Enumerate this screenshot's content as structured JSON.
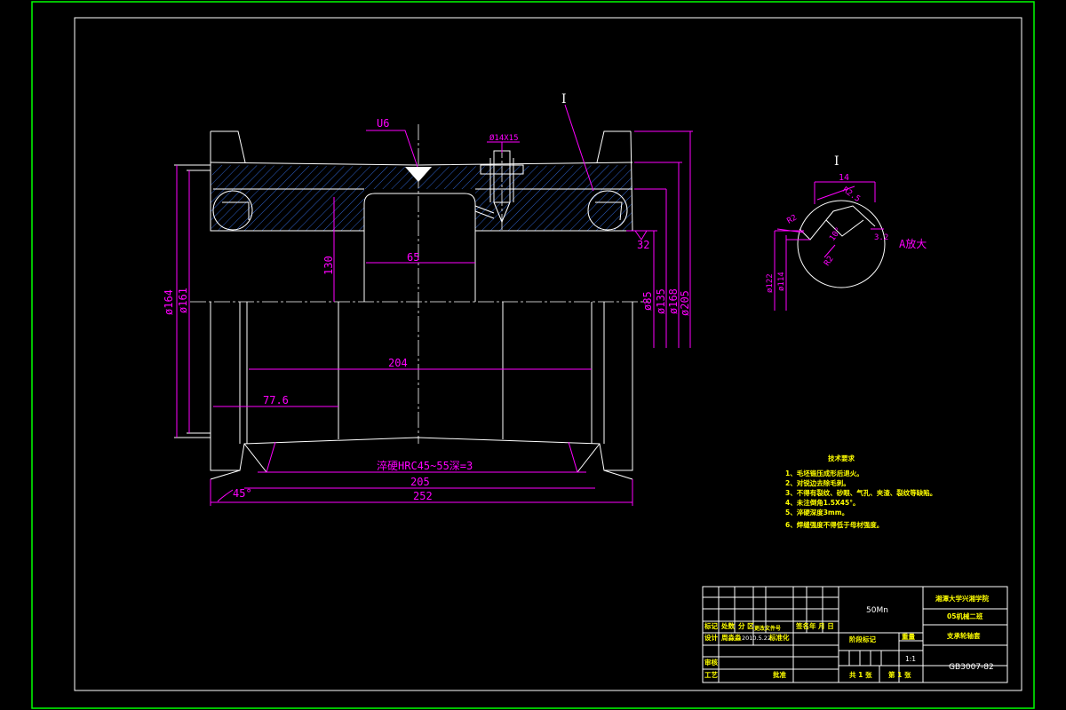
{
  "drawing": {
    "section_label": "I",
    "weld_symbol": "U6",
    "hole_callout": "Ø14X15",
    "dims": {
      "d164": "ø164",
      "d161": "ø161",
      "h130": "130",
      "w65": "65",
      "w204": "204",
      "w77_6": "77.6",
      "w205": "205",
      "w252": "252",
      "a45": "45°",
      "r32": "32",
      "d85": "ø85",
      "d135": "ø135",
      "d168": "ø168",
      "d205": "ø205",
      "hardening": "淬硬HRC45~55深=3"
    }
  },
  "detail": {
    "label": "I",
    "enlarge": "A放大",
    "dim14": "14",
    "r25": "R2.5",
    "r2a": "R2",
    "r2b": "R2",
    "ang": "10°",
    "r32b": "3.2",
    "d122": "ø122",
    "d114": "ø114"
  },
  "tech": {
    "title": "技术要求",
    "items": [
      "1、毛坯锻压成形后退火。",
      "2、对锐边去除毛刺。",
      "3、不得有裂纹、砂眼、气孔、夹渣、裂纹等缺陷。",
      "4、未注倒角1.5X45°。",
      "5、淬硬深度3mm。",
      "6、焊缝强度不得低于母材强度。"
    ]
  },
  "title_block": {
    "material": "50Mn",
    "school": "湘潭大学兴湘学院",
    "class": "05机械二班",
    "part_name": "支承轮轴套",
    "drawing_no": "GB3007-82",
    "mark": "标记",
    "count": "处数",
    "zone": "分 区",
    "change_doc": "更改文件号",
    "sign": "签名",
    "date_ymd": "年 月 日",
    "design": "设计",
    "designer": "周淼淼",
    "design_date": "2010.5.22",
    "standardize": "标准化",
    "stage_mark": "阶段标记",
    "weight": "重量",
    "ratio_label": "比例",
    "ratio": "1:1",
    "review": "审核",
    "process": "工艺",
    "approve": "批准",
    "sheets_total": "共 1 张",
    "sheet_no": "第 1 张"
  }
}
